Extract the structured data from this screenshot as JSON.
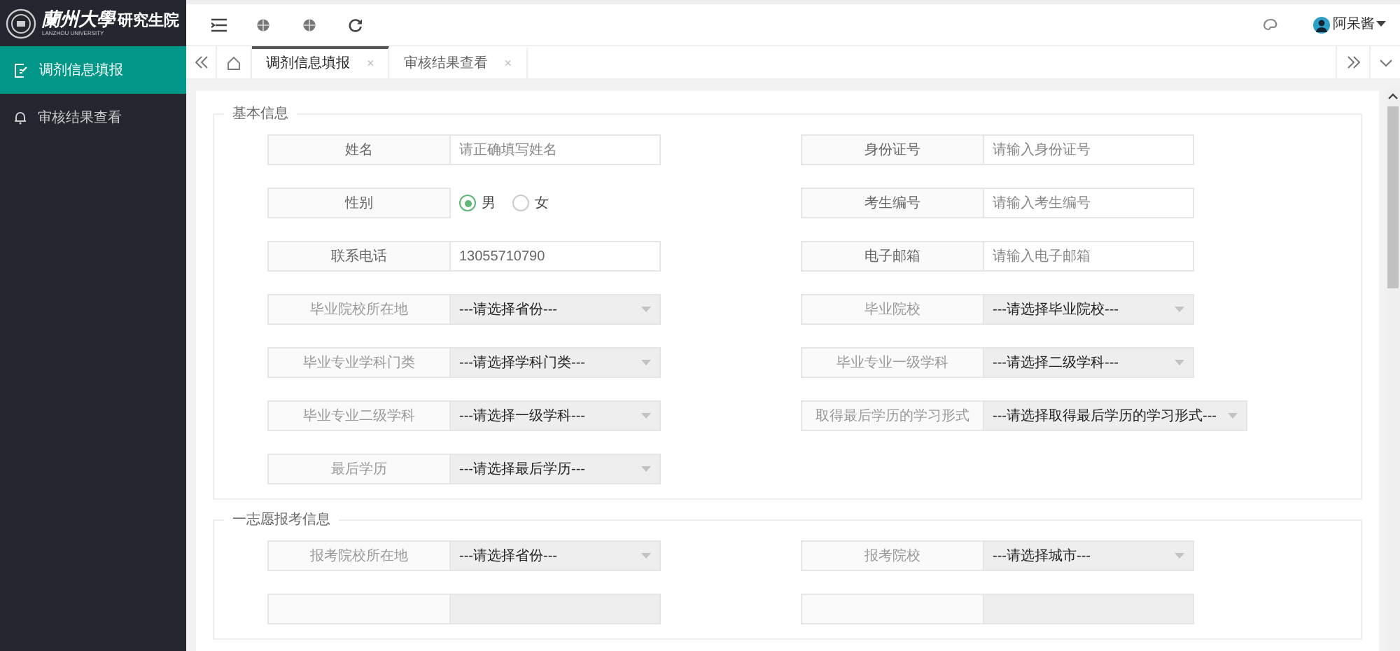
{
  "logo": {
    "title": "蘭州大學",
    "subtitle": "研究生院",
    "english": "LANZHOU UNIVERSITY"
  },
  "sidebar": {
    "items": [
      {
        "label": "调剂信息填报",
        "kind": "form",
        "selected": true
      },
      {
        "label": "审核结果查看",
        "kind": "bell",
        "selected": false
      }
    ]
  },
  "topbar": {
    "user": "阿呆酱"
  },
  "tabs": [
    {
      "label": "调剂信息填报",
      "close": "×",
      "selected": true
    },
    {
      "label": "审核结果查看",
      "close": "×",
      "selected": false
    }
  ],
  "sections": [
    {
      "legend": "基本信息",
      "fields": [
        {
          "label": "姓名",
          "kind": "text",
          "placeholder": "请正确填写姓名"
        },
        {
          "label": "身份证号",
          "kind": "text",
          "placeholder": "请输入身份证号"
        },
        {
          "label": "性别",
          "kind": "radio",
          "options": [
            {
              "label": "男",
              "selected": true
            },
            {
              "label": "女",
              "selected": false
            }
          ]
        },
        {
          "label": "考生编号",
          "kind": "text",
          "placeholder": "请输入考生编号"
        },
        {
          "label": "联系电话",
          "kind": "text",
          "value": "13055710790"
        },
        {
          "label": "电子邮箱",
          "kind": "text",
          "placeholder": "请输入电子邮箱"
        },
        {
          "label": "毕业院校所在地",
          "kind": "select",
          "value": "---请选择省份---"
        },
        {
          "label": "毕业院校",
          "kind": "select",
          "value": "---请选择毕业院校---"
        },
        {
          "label": "毕业专业学科门类",
          "kind": "select",
          "value": "---请选择学科门类---"
        },
        {
          "label": "毕业专业一级学科",
          "kind": "select",
          "value": "---请选择二级学科---"
        },
        {
          "label": "毕业专业二级学科",
          "kind": "select",
          "value": "---请选择一级学科---"
        },
        {
          "label": "取得最后学历的学习形式",
          "kind": "select",
          "value": "---请选择取得最后学历的学习形式---"
        },
        {
          "label": "最后学历",
          "kind": "select",
          "value": "---请选择最后学历---"
        }
      ]
    },
    {
      "legend": "一志愿报考信息",
      "fields": [
        {
          "label": "报考院校所在地",
          "kind": "select",
          "value": "---请选择省份---"
        },
        {
          "label": "报考院校",
          "kind": "select",
          "value": "---请选择城市---"
        },
        {
          "kind": "select_cut"
        },
        {
          "kind": "select_cut"
        }
      ]
    }
  ]
}
